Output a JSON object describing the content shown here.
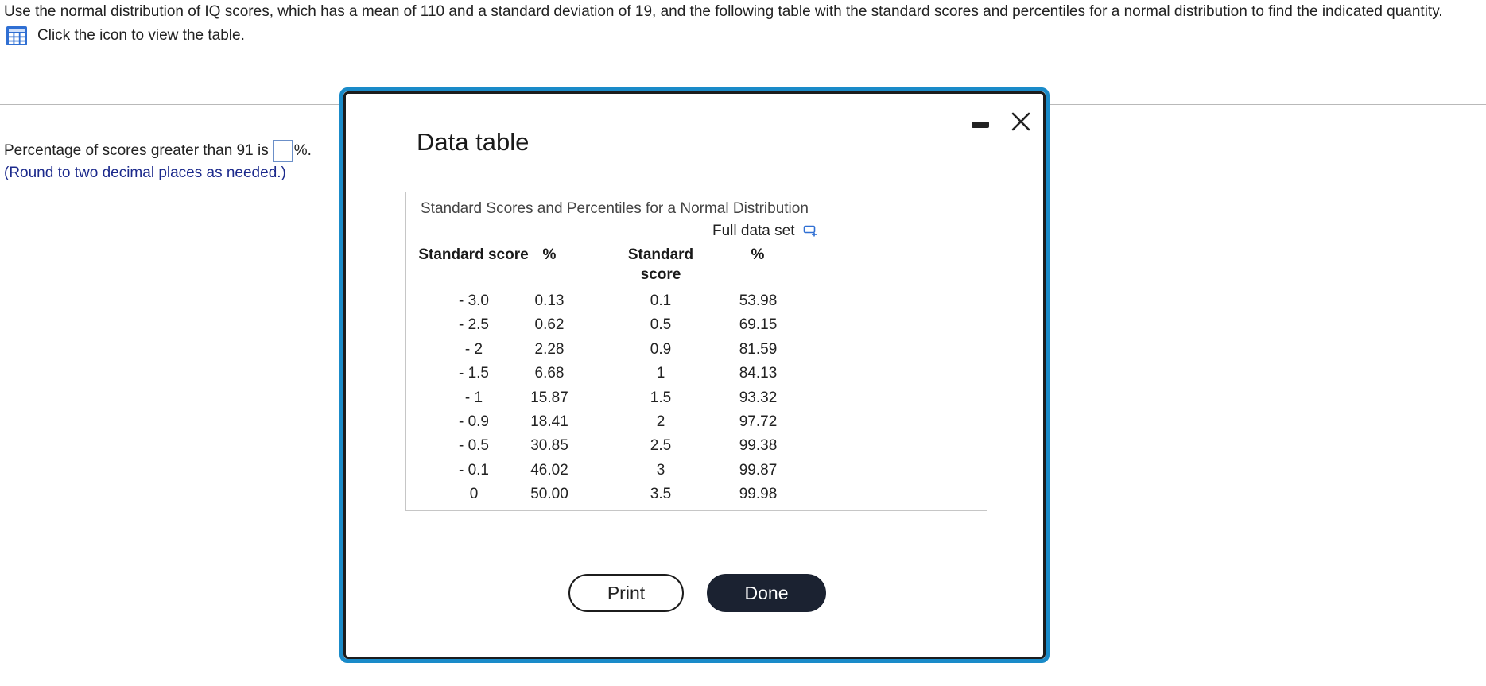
{
  "question": {
    "text": "Use the normal distribution of IQ scores, which has a mean of 110 and a standard deviation of 19, and the following table with the standard scores and percentiles for a normal distribution to find the indicated quantity.",
    "table_link_label": "Click the icon to view the table."
  },
  "answer": {
    "prefix": "Percentage of scores greater than 91 is",
    "suffix": "%.",
    "value": "",
    "hint": "(Round to two decimal places as needed.)"
  },
  "dialog": {
    "title": "Data table",
    "table_caption": "Standard Scores and Percentiles for a Normal Distribution",
    "full_data_label": "Full data set",
    "headers": {
      "score1": "Standard score",
      "pct1": "%",
      "score2_line1": "Standard",
      "score2_line2": "score",
      "pct2": "%"
    },
    "rows": [
      {
        "score1": "- 3.0",
        "pct1": "0.13",
        "score2": "0.1",
        "pct2": "53.98"
      },
      {
        "score1": "- 2.5",
        "pct1": "0.62",
        "score2": "0.5",
        "pct2": "69.15"
      },
      {
        "score1": "- 2",
        "pct1": "2.28",
        "score2": "0.9",
        "pct2": "81.59"
      },
      {
        "score1": "- 1.5",
        "pct1": "6.68",
        "score2": "1",
        "pct2": "84.13"
      },
      {
        "score1": "- 1",
        "pct1": "15.87",
        "score2": "1.5",
        "pct2": "93.32"
      },
      {
        "score1": "- 0.9",
        "pct1": "18.41",
        "score2": "2",
        "pct2": "97.72"
      },
      {
        "score1": "- 0.5",
        "pct1": "30.85",
        "score2": "2.5",
        "pct2": "99.38"
      },
      {
        "score1": "- 0.1",
        "pct1": "46.02",
        "score2": "3",
        "pct2": "99.87"
      },
      {
        "score1": "0",
        "pct1": "50.00",
        "score2": "3.5",
        "pct2": "99.98"
      }
    ],
    "print_label": "Print",
    "done_label": "Done"
  },
  "icons": {
    "table": "table-grid-icon",
    "minimize": "minimize-icon",
    "close": "close-icon",
    "download": "download-icon"
  },
  "colors": {
    "dialog_border": "#1a8bc9",
    "hint_text": "#1c2a8c",
    "done_button": "#1b2231",
    "table_icon": "#2f6fd3"
  }
}
